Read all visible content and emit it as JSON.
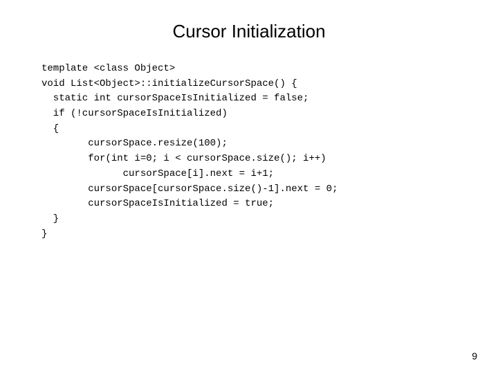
{
  "slide": {
    "title": "Cursor Initialization",
    "code_lines": [
      "template <class Object>",
      "void List<Object>::initializeCursorSpace() {",
      "  static int cursorSpaceIsInitialized = false;",
      "  if (!cursorSpaceIsInitialized)",
      "  {",
      "        cursorSpace.resize(100);",
      "        for(int i=0; i < cursorSpace.size(); i++)",
      "              cursorSpace[i].next = i+1;",
      "        cursorSpace[cursorSpace.size()-1].next = 0;",
      "        cursorSpaceIsInitialized = true;",
      "  }",
      "}"
    ],
    "page_number": "9"
  }
}
